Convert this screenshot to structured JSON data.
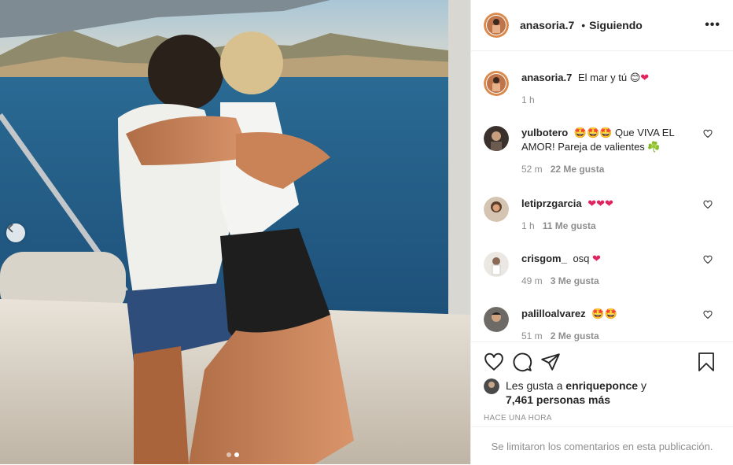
{
  "post": {
    "author": "anasoria.7",
    "follow_status": "Siguiendo",
    "more_label": "•••",
    "dot_separator": "•",
    "caption": {
      "username": "anasoria.7",
      "text": "El mar y tú 😊",
      "time": "1 h"
    },
    "comments": [
      {
        "username": "yulbotero",
        "text_prefix": "🤩🤩🤩 Que VIVA EL AMOR! Pareja de valientes ☘️",
        "time": "52 m",
        "likes": "22 Me gusta",
        "avatar_color": "#3a302c"
      },
      {
        "username": "letiprzgarcia",
        "text_prefix": "",
        "time": "1 h",
        "likes": "11 Me gusta",
        "avatar_color": "#b88a66"
      },
      {
        "username": "crisgom_",
        "text_prefix": "osq",
        "time": "49 m",
        "likes": "3 Me gusta",
        "avatar_color": "#e9e4df"
      },
      {
        "username": "palilloalvarez",
        "text_prefix": "🤩🤩",
        "time": "51 m",
        "likes": "2 Me gusta",
        "avatar_color": "#555"
      }
    ],
    "liked_by": {
      "prefix": "Les gusta a",
      "user": "enriqueponce",
      "connector": "y",
      "others": "7,461 personas más"
    },
    "timestamp": "HACE UNA HORA",
    "comments_disabled": "Se limitaron los comentarios en esta publicación."
  },
  "carousel": {
    "total": 2,
    "active": 2
  },
  "icons": {
    "like": "heart-outline-icon",
    "comment": "comment-icon",
    "share": "send-icon",
    "save": "bookmark-icon",
    "prev": "chevron-left-icon",
    "more": "ellipsis-icon"
  },
  "colors": {
    "accent_heart": "#e0245e",
    "meta_gray": "#8e8e8e",
    "border": "#efefef"
  }
}
